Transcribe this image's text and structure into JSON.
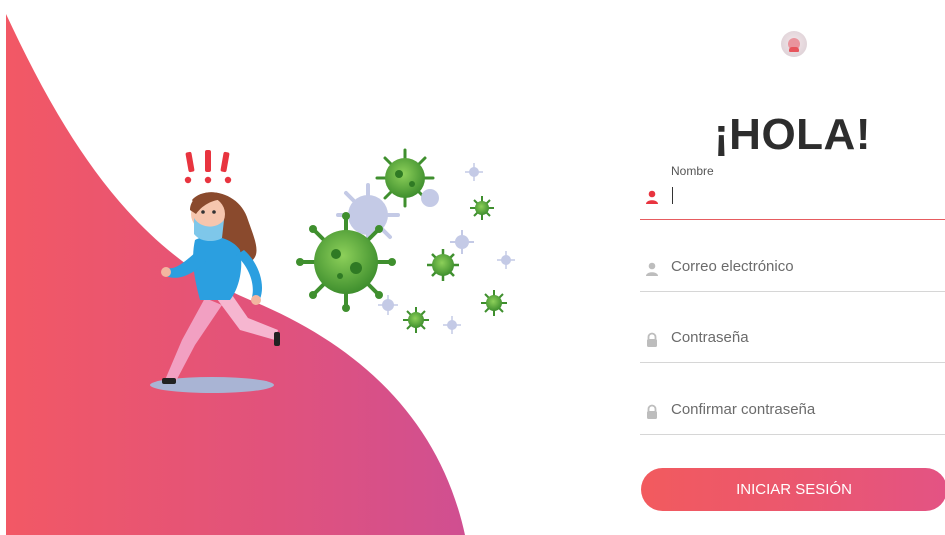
{
  "greeting": "¡HOLA!",
  "form": {
    "name": {
      "label": "Nombre",
      "value": ""
    },
    "email": {
      "placeholder": "Correo electrónico"
    },
    "password": {
      "placeholder": "Contraseña"
    },
    "confirm": {
      "placeholder": "Confirmar contraseña"
    },
    "submit_label": "INICIAR SESIÓN"
  },
  "icons": {
    "name": "user-icon",
    "email": "user-icon",
    "password": "lock-icon",
    "confirm": "lock-icon",
    "logo": "app-logo"
  },
  "colors": {
    "accent": "#e85a5f",
    "gradient_start": "#f25a5e",
    "gradient_end": "#d64f8e",
    "title": "#2d2d2d",
    "virus": "#5aa83a"
  }
}
